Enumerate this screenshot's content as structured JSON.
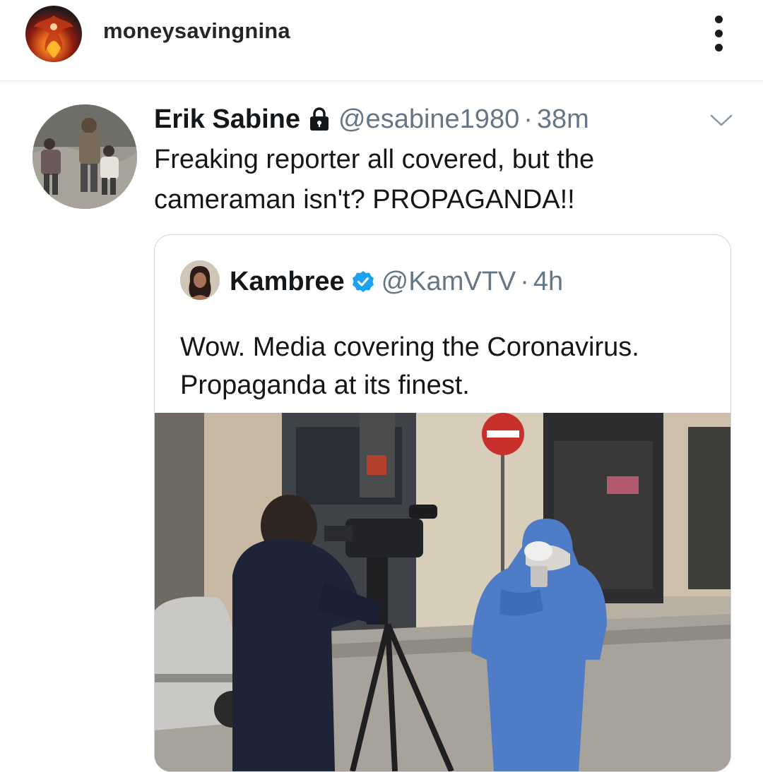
{
  "instagram": {
    "username": "moneysavingnina",
    "icons": {
      "avatar": "profile-avatar",
      "more": "more-options-icon"
    }
  },
  "tweet": {
    "name": "Erik Sabine",
    "handle": "@esabine1980",
    "separator": "·",
    "time": "38m",
    "text": "Freaking reporter all covered, but the cameraman isn't? PROPAGANDA!!",
    "icons": {
      "lock": "lock-icon",
      "menu": "chevron-down-icon"
    }
  },
  "quoted_tweet": {
    "name": "Kambree",
    "handle": "@KamVTV",
    "separator": "·",
    "time": "4h",
    "text": "Wow. Media covering the Coronavirus. Propaganda at its finest.",
    "icons": {
      "verified": "verified-badge-icon"
    },
    "media": "photo of a cameraman filming a reporter in a blue hazmat suit and mask"
  },
  "colors": {
    "text_primary": "#14171a",
    "text_secondary": "#657786",
    "verified_blue": "#1da1f2",
    "card_border": "#ccd6dd"
  }
}
